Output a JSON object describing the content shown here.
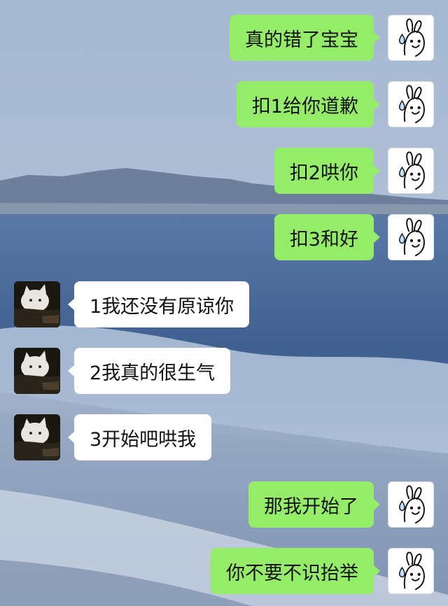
{
  "conversation": {
    "messages": [
      {
        "side": "out",
        "text": "真的错了宝宝",
        "avatar": "bunny-sweat-icon"
      },
      {
        "side": "out",
        "text": "扣1给你道歉",
        "avatar": "bunny-sweat-icon"
      },
      {
        "side": "out",
        "text": "扣2哄你",
        "avatar": "bunny-sweat-icon"
      },
      {
        "side": "out",
        "text": "扣3和好",
        "avatar": "bunny-sweat-icon"
      },
      {
        "side": "in",
        "text": "1我还没有原谅你",
        "avatar": "white-cat-photo"
      },
      {
        "side": "in",
        "text": "2我真的很生气",
        "avatar": "white-cat-photo"
      },
      {
        "side": "in",
        "text": "3开始吧哄我",
        "avatar": "white-cat-photo"
      },
      {
        "side": "out",
        "text": "那我开始了",
        "avatar": "bunny-sweat-icon"
      },
      {
        "side": "out",
        "text": "你不要不识抬举",
        "avatar": "bunny-sweat-icon"
      }
    ]
  },
  "colors": {
    "outgoing_bubble": "#95ec69",
    "incoming_bubble": "#ffffff",
    "sky": "#a9bdd6",
    "sea": "#4f6f9c"
  }
}
